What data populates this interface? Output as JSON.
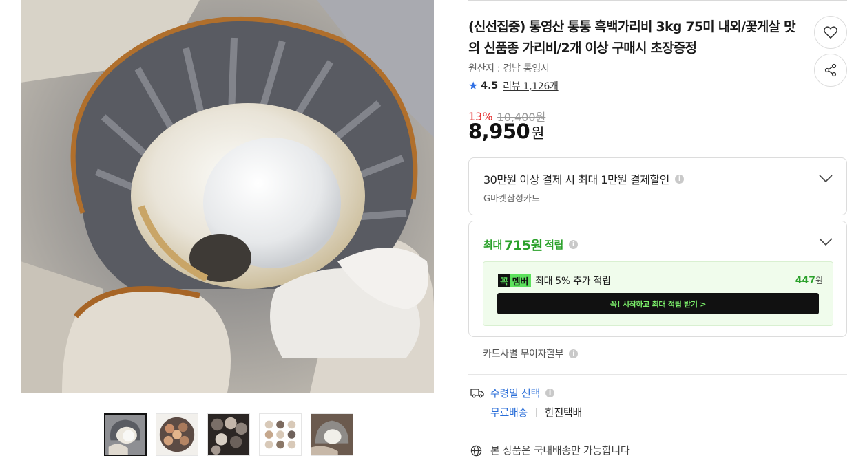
{
  "product": {
    "title": "(신선집중) 통영산 통통 흑백가리비 3kg 75미 내외/꽃게살 맛의 신품종 가리비/2개 이상 구매시 초장증정",
    "origin": "원산지 : 경남 통영시",
    "rating": "4.5",
    "review_label": "리뷰 1,126개"
  },
  "price": {
    "discount_rate": "13%",
    "original": "10,400원",
    "sale_amount": "8,950",
    "sale_unit": "원"
  },
  "card_benefit": {
    "title": "30만원 이상 결제 시 최대 1만원 결제할인",
    "card_name": "G마켓삼성카드"
  },
  "points": {
    "prefix": "최대",
    "amount": "715원",
    "suffix": "적립",
    "member_badge_k": "꼭",
    "member_badge_label": "멤버",
    "member_text": "최대 5% 추가 적립",
    "member_amount": "447",
    "member_amount_unit": "원",
    "cta_label": "꼭! 시작하고 최대 적립 받기 >"
  },
  "installment": "카드사별 무이자할부",
  "delivery": {
    "title": "수령일 선택",
    "free": "무료배송",
    "courier": "한진택배"
  },
  "domestic_notice": "본 상품은 국내배송만 가능합니다",
  "colors": {
    "accent_blue": "#2a6ed8",
    "discount_red": "#e42a2a",
    "point_green": "#2ba12b"
  },
  "icons": [
    "heart-icon",
    "share-icon",
    "star-icon",
    "chevron-down-icon",
    "info-icon",
    "truck-icon",
    "globe-icon"
  ]
}
